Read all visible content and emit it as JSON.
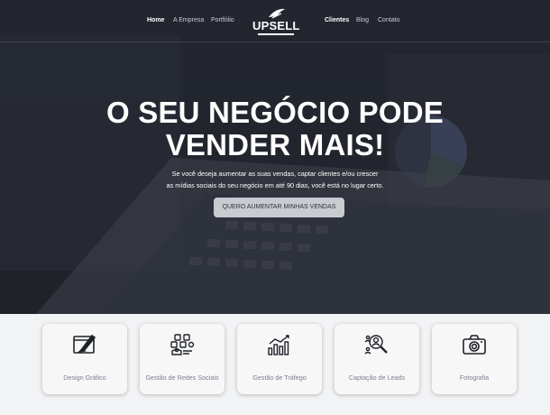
{
  "nav": {
    "left_items": [
      {
        "label": "Home",
        "active": true
      },
      {
        "label": "A Empresa",
        "active": false
      },
      {
        "label": "Portfólio",
        "active": false
      }
    ],
    "right_items": [
      {
        "label": "Clientes",
        "active": true
      },
      {
        "label": "Blog",
        "active": false
      },
      {
        "label": "Contato",
        "active": false
      }
    ],
    "logo_text": "UPSELL"
  },
  "hero": {
    "headline_line1": "O SEU NEGÓCIO PODE",
    "headline_line2": "VENDER MAIS!",
    "subtext_line1": "Se você deseja aumentar as suas vendas, captar clientes e/ou crescer",
    "subtext_line2": "as mídias sociais do seu negócio em até 90 dias, você está no lugar certo.",
    "cta_label": "QUERO AUMENTAR MINHAS VENDAS"
  },
  "services": [
    {
      "label": "Design Gráfico",
      "icon": "design-icon"
    },
    {
      "label": "Gestão de Redes Sociais",
      "icon": "social-network-icon"
    },
    {
      "label": "Gestão de Tráfego",
      "icon": "traffic-chart-icon"
    },
    {
      "label": "Captação de Leads",
      "icon": "leads-search-icon"
    },
    {
      "label": "Fotografia",
      "icon": "camera-icon"
    }
  ],
  "colors": {
    "hero_bg": "#2a2d37",
    "cta_bg": "#c9cbd0",
    "services_bg": "#f2f3f5",
    "card_text": "#7b8090"
  }
}
